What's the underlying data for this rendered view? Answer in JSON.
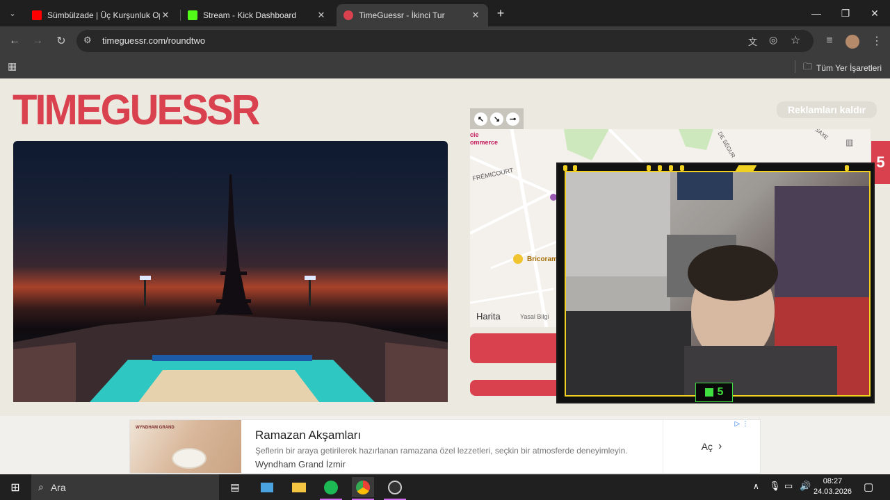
{
  "browser": {
    "tabs": [
      {
        "title": "Sümbülzade | Üç Kurşunluk Op",
        "favicon_color": "#ff0000"
      },
      {
        "title": "Stream - Kick Dashboard",
        "favicon_color": "#53fc18"
      },
      {
        "title": "TimeGuessr - İkinci Tur",
        "favicon_color": "#d9414e"
      }
    ],
    "new_tab": "+",
    "url": "timeguessr.com/roundtwo",
    "bookmarks_all": "Tüm Yer İşaretleri"
  },
  "page": {
    "logo": "TIMEGUESSR",
    "remove_ads": "Reklamları kaldır",
    "red_tab_text": "5",
    "map": {
      "labels": [
        "FRÉMICOURT",
        "Bricoram",
        "cie",
        "ommerce",
        "DE SÉGUR",
        "SAXE"
      ],
      "apple_maps": "Harita",
      "legal": "Yasal Bilgi"
    },
    "webcam": {
      "badge_number": "5"
    }
  },
  "ad": {
    "title": "Ramazan Akşamları",
    "description": "Şeflerin bir araya getirilerek hazırlanan ramazana özel lezzetleri, seçkin bir atmosferde deneyimleyin.",
    "source": "Wyndham Grand İzmir",
    "cta": "Aç",
    "image_text": [
      "WYNDHAM GRAND"
    ]
  },
  "taskbar": {
    "search_placeholder": "Ara",
    "time": "08:27",
    "date": "24.03.2026"
  }
}
